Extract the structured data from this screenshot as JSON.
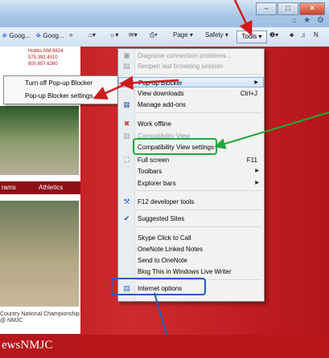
{
  "favorites": [
    {
      "label": "Goog..."
    },
    {
      "label": "Goog..."
    }
  ],
  "command_bar": {
    "page_label": "Page",
    "safety_label": "Safety",
    "tools_label": "Tools"
  },
  "page": {
    "logo_lines": [
      "Hobbs NM 8824",
      "575.392.4510",
      "800.657.6260"
    ],
    "nav": [
      "rams",
      "Athletics"
    ],
    "caption": "Country National Championship @ NMJC",
    "news_banner": "ewsNMJC"
  },
  "popup_submenu": {
    "items": [
      "Turn off Pop-up Blocker",
      "Pop-up Blocker settings"
    ]
  },
  "tools_menu": {
    "items": [
      {
        "label": "Diagnose connection problems...",
        "icon": "diagnose-icon",
        "disabled": true
      },
      {
        "label": "Reopen last browsing session",
        "icon": "reopen-icon",
        "disabled": true
      },
      {
        "label": "Pop-up Blocker",
        "icon": "popup-blocker-icon",
        "submenu": true
      },
      {
        "label": "View downloads",
        "icon": "downloads-icon",
        "shortcut": "Ctrl+J"
      },
      {
        "label": "Manage add-ons",
        "icon": "addons-icon"
      },
      {
        "label": "Work offline",
        "icon": "offline-icon"
      },
      {
        "label": "Compatibility View",
        "icon": "compat-icon",
        "disabled": true
      },
      {
        "label": "Compatibility View settings"
      },
      {
        "label": "Full screen",
        "icon": "fullscreen-icon",
        "shortcut": "F11"
      },
      {
        "label": "Toolbars",
        "submenu": true
      },
      {
        "label": "Explorer bars",
        "submenu": true
      },
      {
        "label": "F12 developer tools",
        "icon": "devtools-icon"
      },
      {
        "label": "Suggested Sites",
        "icon": "check-icon"
      },
      {
        "label": "Skype Click to Call"
      },
      {
        "label": "OneNote Linked Notes"
      },
      {
        "label": "Send to OneNote"
      },
      {
        "label": "Blog This in Windows Live Writer"
      },
      {
        "label": "Internet options",
        "icon": "internet-options-icon"
      }
    ]
  },
  "annotation_colors": {
    "arrow": "#d11a1a",
    "green_box": "#22a83a",
    "blue_box": "#1f5fbf"
  }
}
